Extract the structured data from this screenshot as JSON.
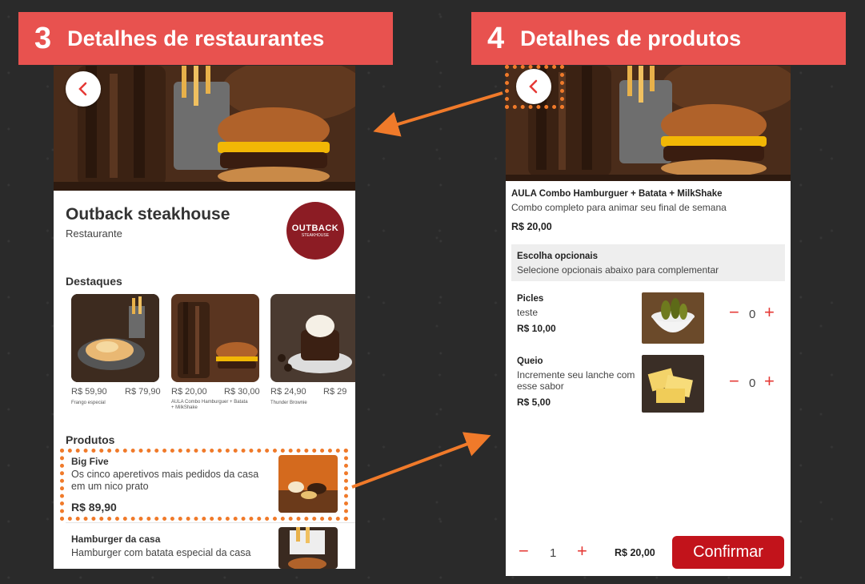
{
  "banners": [
    {
      "number": "3",
      "title": "Detalhes de restaurantes"
    },
    {
      "number": "4",
      "title": "Detalhes de produtos"
    }
  ],
  "restaurant": {
    "name": "Outback steakhouse",
    "type": "Restaurante",
    "logo_text": "OUTBACK",
    "logo_subtext": "STEAKHOUSE",
    "highlights_title": "Destaques",
    "highlights": [
      {
        "price": "R$ 59,90",
        "old_price": "R$ 79,90",
        "name": "Frango especial"
      },
      {
        "price": "R$ 20,00",
        "old_price": "R$ 30,00",
        "name": "AULA Combo Hamburguer + Batata + MilkShake"
      },
      {
        "price": "R$ 24,90",
        "old_price": "R$ 29",
        "name": "Thunder Brownie"
      }
    ],
    "products_title": "Produtos",
    "products": [
      {
        "name": "Big Five",
        "desc": "Os cinco aperetivos mais pedidos da casa em um nico prato",
        "price": "R$ 89,90"
      },
      {
        "name": "Hamburger da casa",
        "desc": "Hamburger com batata especial da casa",
        "price": ""
      }
    ]
  },
  "product": {
    "title": "AULA Combo Hamburguer + Batata + MilkShake",
    "subtitle": "Combo completo para animar seu final de semana",
    "price": "R$ 20,00",
    "options_title": "Escolha opcionais",
    "options_subtitle": "Selecione opcionais abaixo para complementar",
    "options": [
      {
        "name": "Picles",
        "desc": "teste",
        "price": "R$ 10,00",
        "qty": "0"
      },
      {
        "name": "Queio",
        "desc": "Incremente seu lanche com esse sabor",
        "price": "R$ 5,00",
        "qty": "0"
      }
    ],
    "footer": {
      "qty": "1",
      "total": "R$ 20,00",
      "confirm_label": "Confirmar"
    }
  },
  "colors": {
    "accent": "#e53935",
    "banner": "#e8524f",
    "highlight_dash": "#f07a2a",
    "confirm": "#c2131b"
  }
}
